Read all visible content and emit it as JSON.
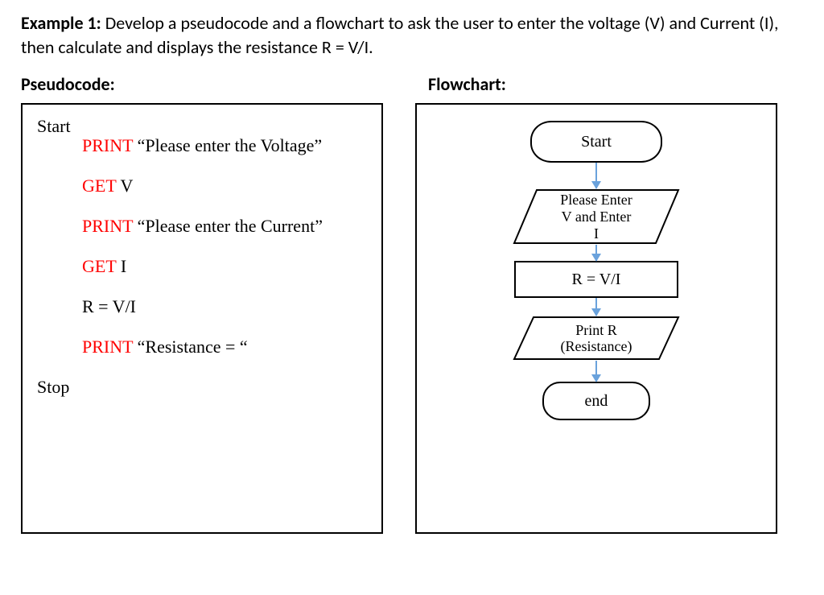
{
  "title": {
    "label": "Example 1:",
    "text": " Develop a pseudocode and a flowchart to ask the user to enter the voltage (V) and Current (I), then calculate and displays the resistance R = V/I."
  },
  "headings": {
    "pseudocode": "Pseudocode:",
    "flowchart": "Flowchart:"
  },
  "pseudocode": {
    "start": "Start",
    "stop": "Stop",
    "lines": [
      {
        "kw": "PRINT",
        "rest": " “Please enter the Voltage”"
      },
      {
        "kw": "GET",
        "rest": " V"
      },
      {
        "kw": "PRINT",
        "rest": " “Please enter the Current”"
      },
      {
        "kw": "GET",
        "rest": " I"
      },
      {
        "kw": "",
        "rest": "R = V/I"
      },
      {
        "kw": "PRINT",
        "rest": " “Resistance = “"
      }
    ]
  },
  "flowchart": {
    "start": "Start",
    "input_l1": "Please Enter",
    "input_l2": "V and Enter",
    "input_l3": "I",
    "process": "R = V/I",
    "output_l1": "Print R",
    "output_l2": "(Resistance)",
    "end": "end"
  }
}
